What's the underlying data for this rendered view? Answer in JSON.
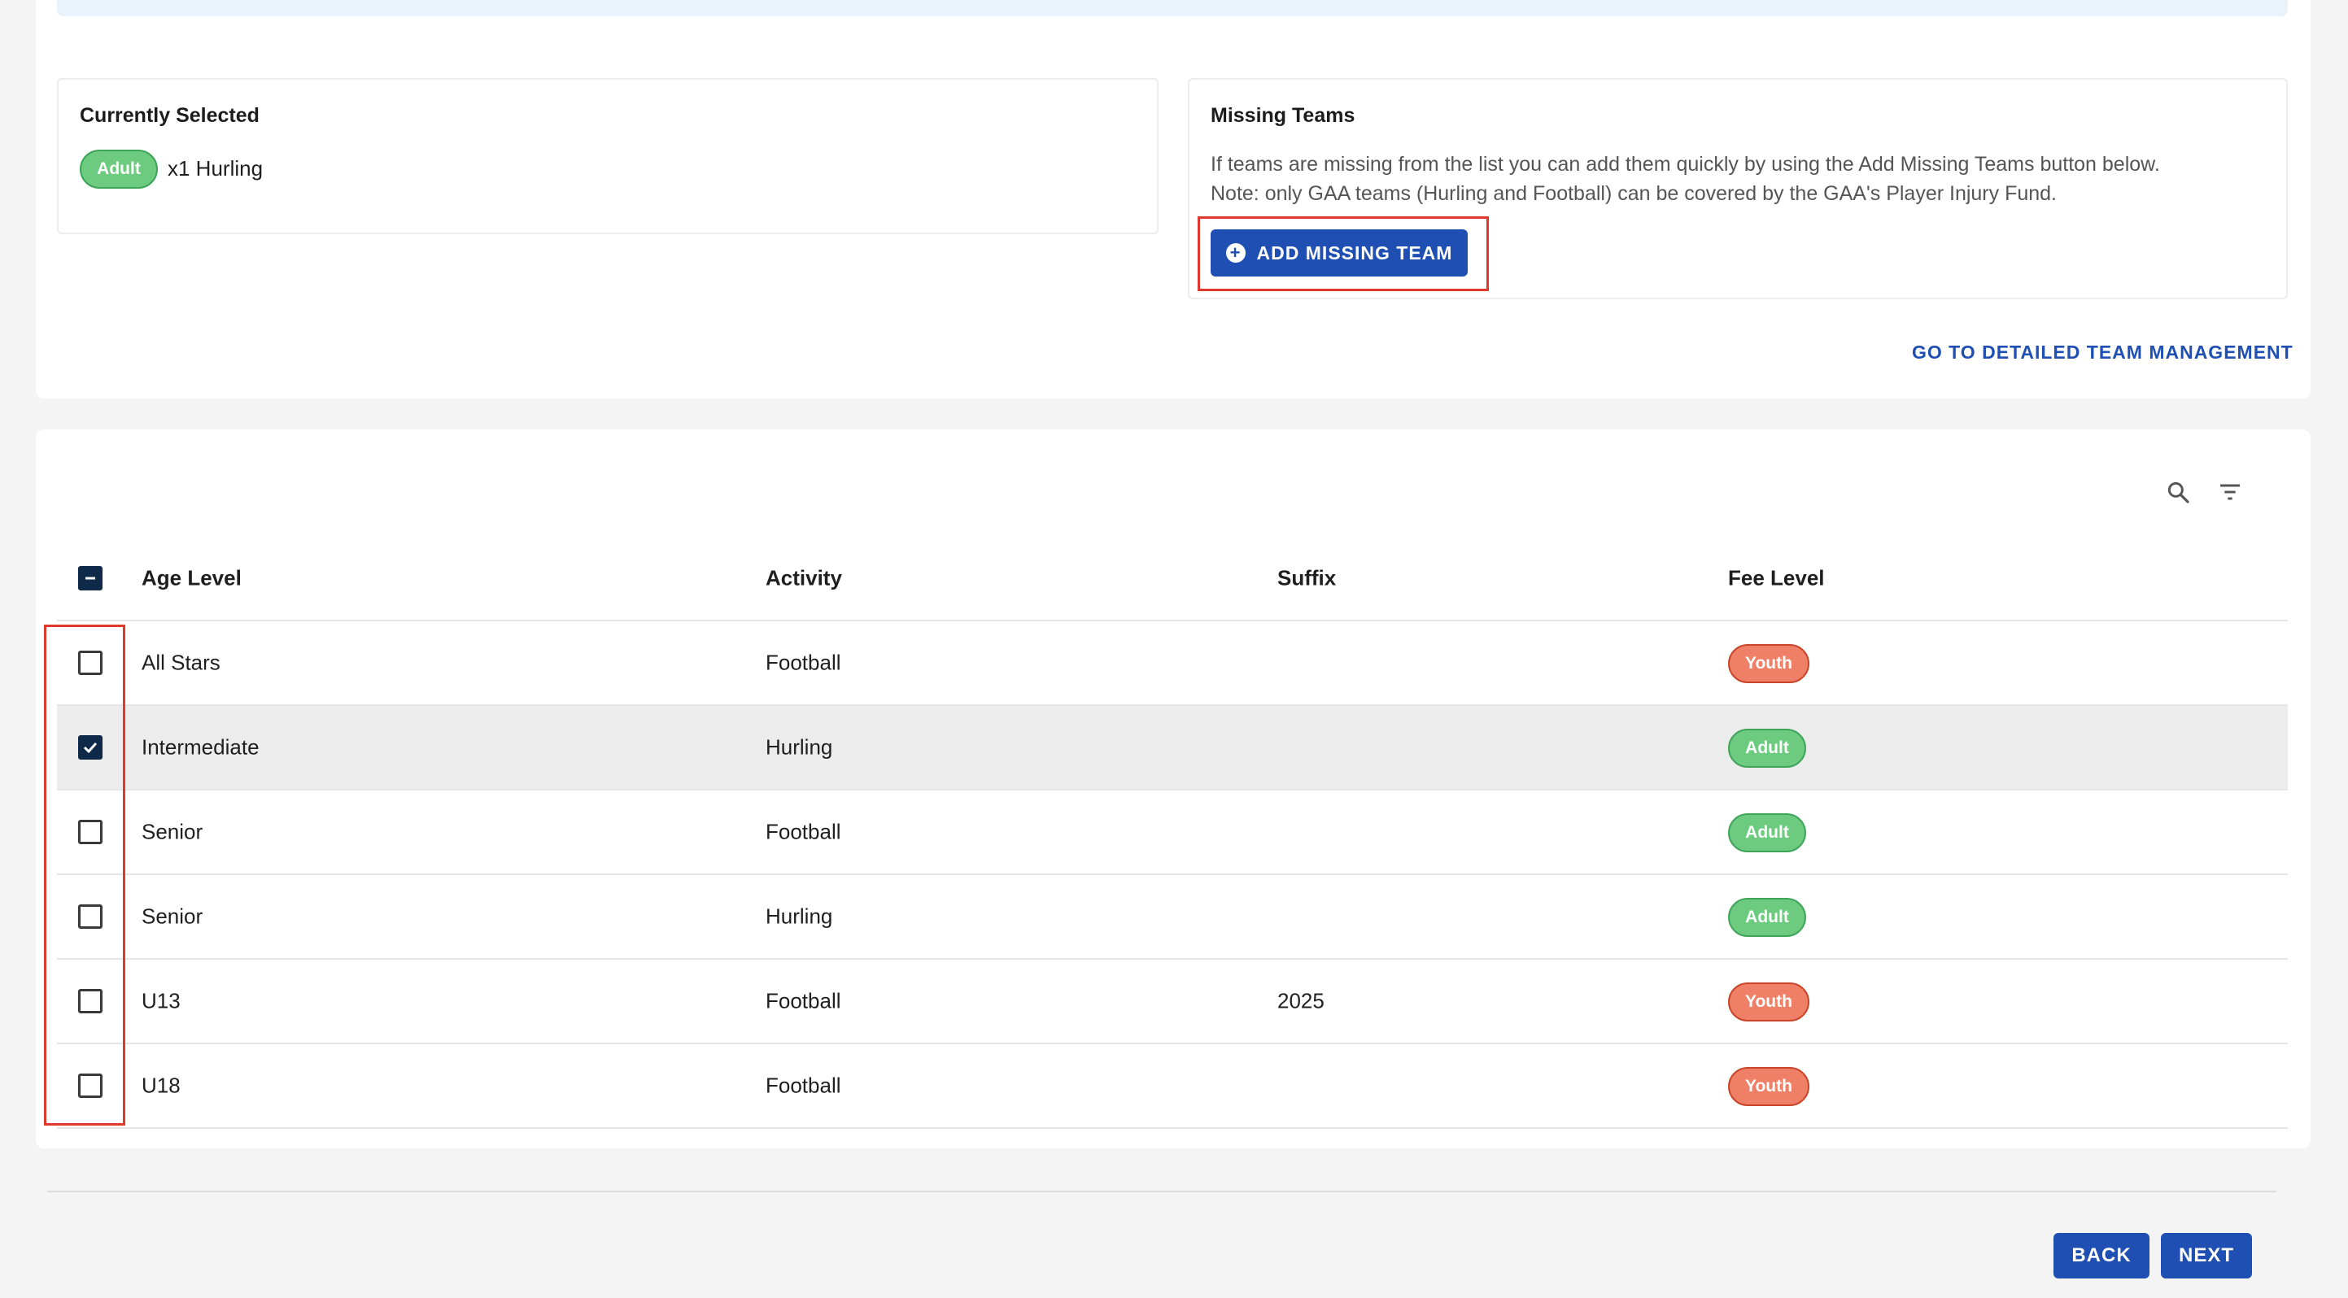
{
  "selected": {
    "title": "Currently Selected",
    "badge": "Adult",
    "text": "x1 Hurling"
  },
  "missing": {
    "title": "Missing Teams",
    "line1": "If teams are missing from the list you can add them quickly by using the Add Missing Teams button below.",
    "line2": "Note: only GAA teams (Hurling and Football) can be covered by the GAA's Player Injury Fund.",
    "button": "ADD MISSING TEAM"
  },
  "detailed_link": "GO TO DETAILED TEAM MANAGEMENT",
  "toolbar": {
    "search_icon": "search-icon",
    "filter_icon": "filter-icon"
  },
  "table": {
    "headers": {
      "age_level": "Age Level",
      "activity": "Activity",
      "suffix": "Suffix",
      "fee_level": "Fee Level"
    },
    "rows": [
      {
        "age": "All Stars",
        "activity": "Football",
        "suffix": "",
        "fee": "Youth",
        "checked": false
      },
      {
        "age": "Intermediate",
        "activity": "Hurling",
        "suffix": "",
        "fee": "Adult",
        "checked": true
      },
      {
        "age": "Senior",
        "activity": "Football",
        "suffix": "",
        "fee": "Adult",
        "checked": false
      },
      {
        "age": "Senior",
        "activity": "Hurling",
        "suffix": "",
        "fee": "Adult",
        "checked": false
      },
      {
        "age": "U13",
        "activity": "Football",
        "suffix": "2025",
        "fee": "Youth",
        "checked": false
      },
      {
        "age": "U18",
        "activity": "Football",
        "suffix": "",
        "fee": "Youth",
        "checked": false
      }
    ]
  },
  "footer": {
    "back": "BACK",
    "next": "NEXT"
  },
  "colors": {
    "primary": "#1f4fb3",
    "adult": "#6ccb7e",
    "youth": "#ef7f66",
    "highlight": "#e0392b"
  }
}
